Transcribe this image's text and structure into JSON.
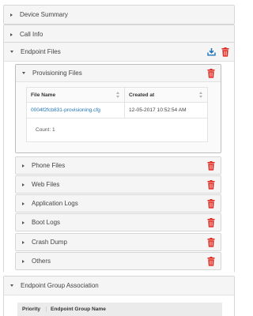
{
  "panels": {
    "device_summary": {
      "title": "Device Summary"
    },
    "call_info": {
      "title": "Call Info"
    },
    "endpoint_files": {
      "title": "Endpoint Files",
      "sections": {
        "provisioning": {
          "title": "Provisioning Files",
          "table": {
            "columns": [
              "File Name",
              "Created at"
            ],
            "rows": [
              {
                "file_name": "0004f2fcb831-provisioning.cfg",
                "created_at": "12-05-2017 10:52:54 AM"
              }
            ],
            "count_label": "Count: 1"
          }
        },
        "phone": {
          "title": "Phone Files"
        },
        "web": {
          "title": "Web Files"
        },
        "application_logs": {
          "title": "Application Logs"
        },
        "boot_logs": {
          "title": "Boot Logs"
        },
        "crash_dump": {
          "title": "Crash Dump"
        },
        "others": {
          "title": "Others"
        }
      }
    },
    "endpoint_group_association": {
      "title": "Endpoint Group Association",
      "columns": [
        "Priority",
        "Endpoint Group Name"
      ]
    }
  },
  "colors": {
    "accent_blue": "#1f73b7",
    "delete_red": "#e0281f"
  },
  "icons": {
    "expand": "caret-right-icon",
    "collapse": "caret-down-icon",
    "download": "download-icon",
    "delete": "trash-icon"
  }
}
